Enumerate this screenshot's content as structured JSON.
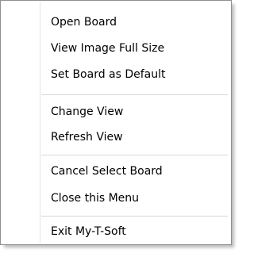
{
  "context_menu": {
    "groups": [
      {
        "items": [
          "Open Board",
          "View Image Full Size",
          "Set Board as Default"
        ]
      },
      {
        "items": [
          "Change View",
          "Refresh View"
        ]
      },
      {
        "items": [
          "Cancel Select Board",
          "Close this Menu"
        ]
      },
      {
        "items": [
          "Exit My-T-Soft"
        ]
      }
    ]
  }
}
